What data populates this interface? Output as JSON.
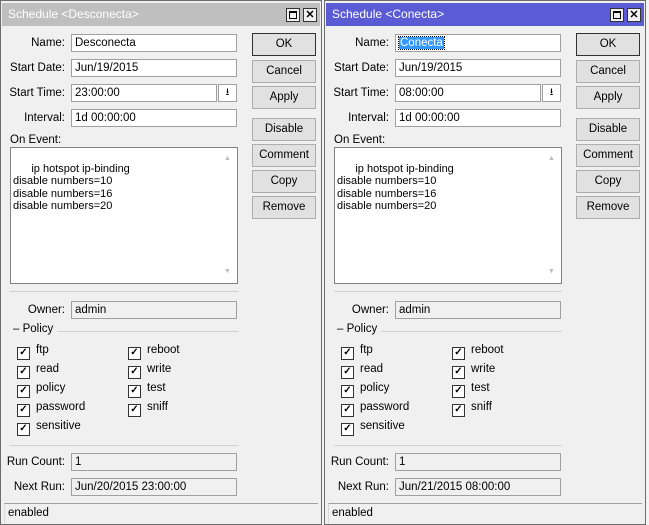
{
  "windows": [
    {
      "title": "Schedule <Desconecta>",
      "active": false,
      "labels": {
        "name": "Name:",
        "start_date": "Start Date:",
        "start_time": "Start Time:",
        "interval": "Interval:",
        "on_event": "On Event:",
        "owner": "Owner:",
        "policy": "Policy",
        "run_count": "Run Count:",
        "next_run": "Next Run:"
      },
      "name": "Desconecta",
      "start_date": "Jun/19/2015",
      "start_time": "23:00:00",
      "interval": "1d 00:00:00",
      "on_event": "ip hotspot ip-binding\ndisable numbers=10\ndisable numbers=16\ndisable numbers=20",
      "owner": "admin",
      "policies": [
        {
          "label": "ftp",
          "checked": true
        },
        {
          "label": "read",
          "checked": true
        },
        {
          "label": "policy",
          "checked": true
        },
        {
          "label": "password",
          "checked": true
        },
        {
          "label": "sensitive",
          "checked": true
        },
        {
          "label": "reboot",
          "checked": true
        },
        {
          "label": "write",
          "checked": true
        },
        {
          "label": "test",
          "checked": true
        },
        {
          "label": "sniff",
          "checked": true
        }
      ],
      "run_count": "1",
      "next_run": "Jun/20/2015 23:00:00",
      "status": "enabled",
      "buttons": [
        "OK",
        "Cancel",
        "Apply",
        "Disable",
        "Comment",
        "Copy",
        "Remove"
      ]
    },
    {
      "title": "Schedule <Conecta>",
      "active": true,
      "labels": {
        "name": "Name:",
        "start_date": "Start Date:",
        "start_time": "Start Time:",
        "interval": "Interval:",
        "on_event": "On Event:",
        "owner": "Owner:",
        "policy": "Policy",
        "run_count": "Run Count:",
        "next_run": "Next Run:"
      },
      "name": "Conecta",
      "start_date": "Jun/19/2015",
      "start_time": "08:00:00",
      "interval": "1d 00:00:00",
      "on_event": "ip hotspot ip-binding\ndisable numbers=10\ndisable numbers=16\ndisable numbers=20",
      "owner": "admin",
      "policies": [
        {
          "label": "ftp",
          "checked": true
        },
        {
          "label": "read",
          "checked": true
        },
        {
          "label": "policy",
          "checked": true
        },
        {
          "label": "password",
          "checked": true
        },
        {
          "label": "sensitive",
          "checked": true
        },
        {
          "label": "reboot",
          "checked": true
        },
        {
          "label": "write",
          "checked": true
        },
        {
          "label": "test",
          "checked": true
        },
        {
          "label": "sniff",
          "checked": true
        }
      ],
      "run_count": "1",
      "next_run": "Jun/21/2015 08:00:00",
      "status": "enabled",
      "buttons": [
        "OK",
        "Cancel",
        "Apply",
        "Disable",
        "Comment",
        "Copy",
        "Remove"
      ]
    }
  ]
}
